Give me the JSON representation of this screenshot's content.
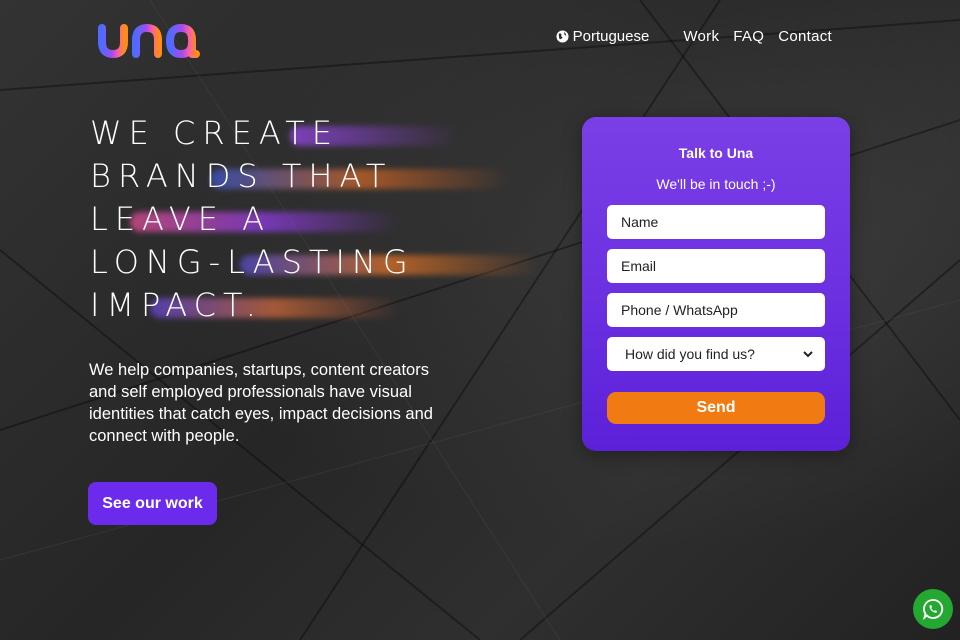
{
  "brand": {
    "logo_text": "una"
  },
  "nav": {
    "language": {
      "label": "Portuguese",
      "icon": "globe-icon"
    },
    "links": [
      "Work",
      "FAQ",
      "Contact"
    ]
  },
  "hero": {
    "title_lines": [
      "WE CREATE",
      "BRANDS THAT",
      "LEAVE A",
      "LONG-LASTING",
      "IMPACT."
    ],
    "description": "We help companies, startups, content creators and self employed professionals have visual identities that catch eyes, impact decisions and connect with people.",
    "cta_label": "See our work"
  },
  "contact_form": {
    "title": "Talk to Una",
    "subtitle": "We'll be in touch ;-)",
    "name_placeholder": "Name",
    "email_placeholder": "Email",
    "phone_placeholder": "Phone / WhatsApp",
    "source_selected": "How did you find us?",
    "send_label": "Send"
  },
  "colors": {
    "accent_purple": "#6c2bec",
    "send_orange": "#f27a12",
    "whatsapp_green": "#25a832"
  },
  "floating": {
    "whatsapp_icon": "whatsapp-icon"
  }
}
